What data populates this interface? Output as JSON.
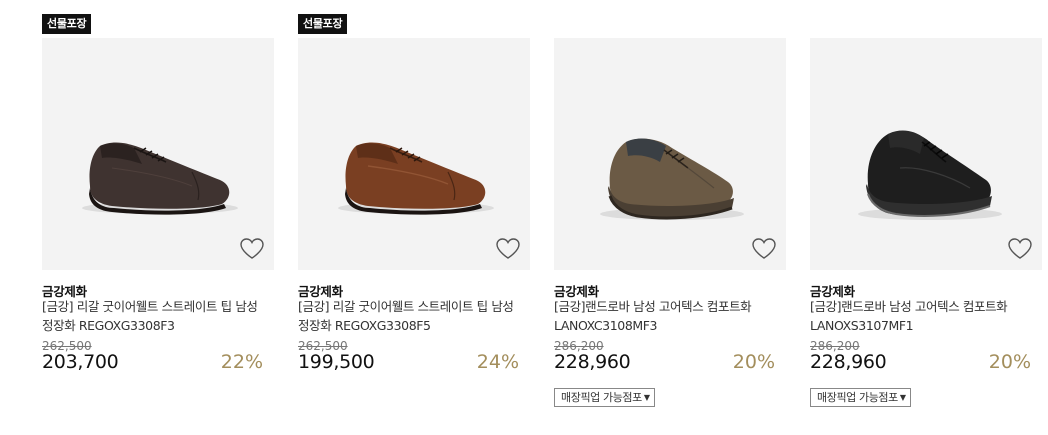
{
  "products": [
    {
      "badge": "선물포장",
      "brand": "금강제화",
      "name": "[금강] 리갈 굿이어웰트 스트레이트 팁 남성 정장화 REGOXG3308F3",
      "original_price": "262,500",
      "price": "203,700",
      "discount": "22%",
      "shoe_color": "#3f3330"
    },
    {
      "badge": "선물포장",
      "brand": "금강제화",
      "name": "[금강] 리갈 굿이어웰트 스트레이트 팁 남성 정장화 REGOXG3308F5",
      "original_price": "262,500",
      "price": "199,500",
      "discount": "24%",
      "shoe_color": "#7a3f22"
    },
    {
      "brand": "금강제화",
      "name": "[금강]랜드로바 남성 고어텍스 컴포트화 LANOXC3108MF3",
      "original_price": "286,200",
      "price": "228,960",
      "discount": "20%",
      "pickup_label": "매장픽업 가능점포",
      "shoe_color": "#6b5a45"
    },
    {
      "brand": "금강제화",
      "name": "[금강]랜드로바 남성 고어텍스 컴포트화 LANOXS3107MF1",
      "original_price": "286,200",
      "price": "228,960",
      "discount": "20%",
      "pickup_label": "매장픽업 가능점포",
      "shoe_color": "#1e1e1e"
    }
  ],
  "colors": {
    "badge_bg": "#111111",
    "thumb_bg": "#f3f3f3",
    "discount": "#a38e5c"
  },
  "icons": {
    "wishlist": "heart-outline-icon",
    "dropdown": "caret-down-icon"
  }
}
